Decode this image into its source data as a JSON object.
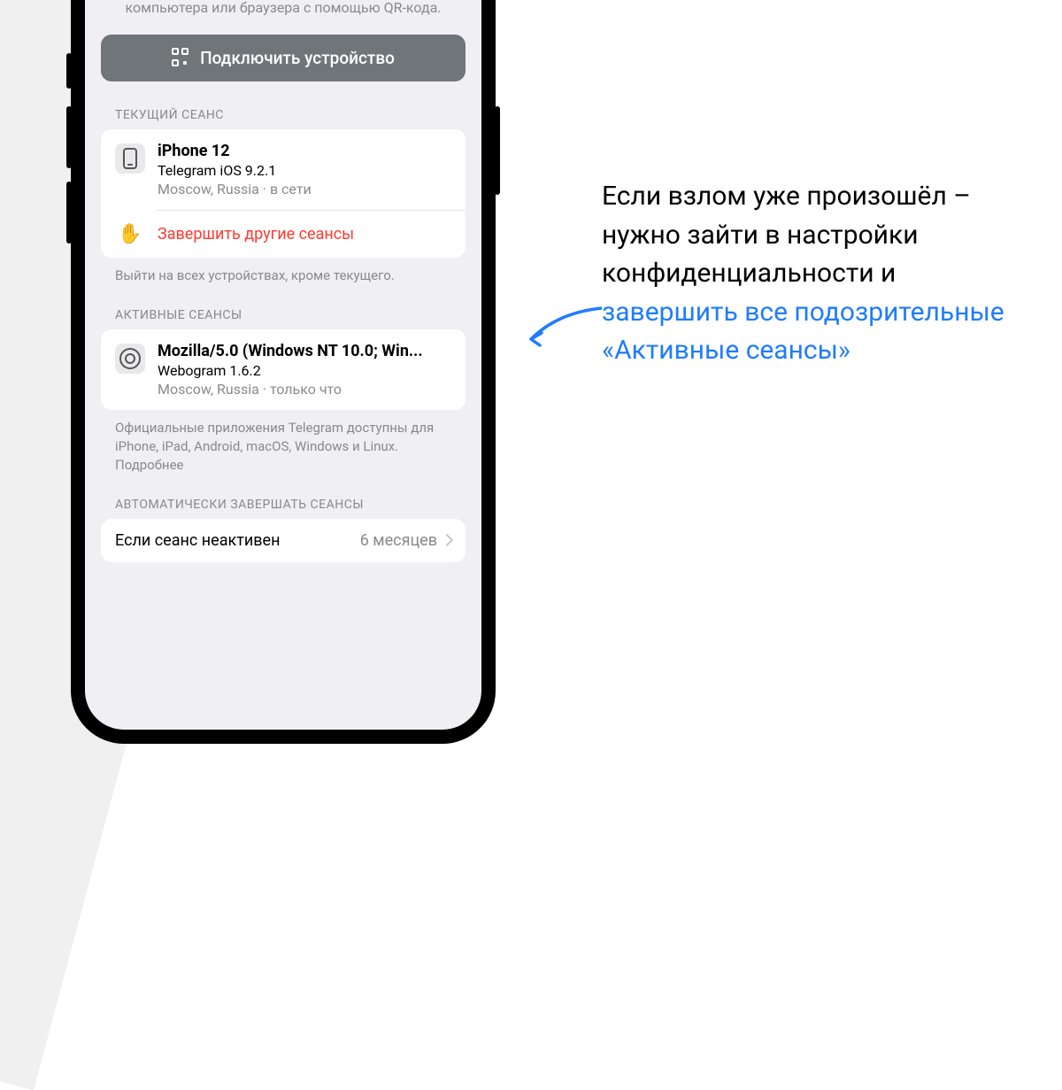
{
  "intro": "Вы можете зайти в приложения Telegram для компьютера или браузера с помощью QR-кода.",
  "connect_label": "Подключить устройство",
  "sections": {
    "current": "ТЕКУЩИЙ СЕАНС",
    "active": "АКТИВНЫЕ СЕАНСЫ",
    "auto": "АВТОМАТИЧЕСКИ ЗАВЕРШАТЬ СЕАНСЫ"
  },
  "current_session": {
    "device": "iPhone 12",
    "client": "Telegram iOS 9.2.1",
    "location": "Moscow, Russia",
    "status": "в сети"
  },
  "terminate_label": "Завершить другие сеансы",
  "terminate_footer": "Выйти на всех устройствах, кроме текущего.",
  "active_session": {
    "device": "Mozilla/5.0 (Windows NT 10.0; Win...",
    "client": "Webogram 1.6.2",
    "location": "Moscow, Russia",
    "status": "только что"
  },
  "active_footer": "Официальные приложения Telegram доступны для iPhone, iPad, Android, macOS, Windows и Linux. Подробнее",
  "auto_terminate": {
    "label": "Если сеанс неактивен",
    "value": "6 месяцев"
  },
  "annotation": {
    "line1": "Если взлом уже произошёл – нужно зайти в настройки конфиденциальности и ",
    "highlight": "завершить все подозрительные «Активные сеансы»"
  }
}
